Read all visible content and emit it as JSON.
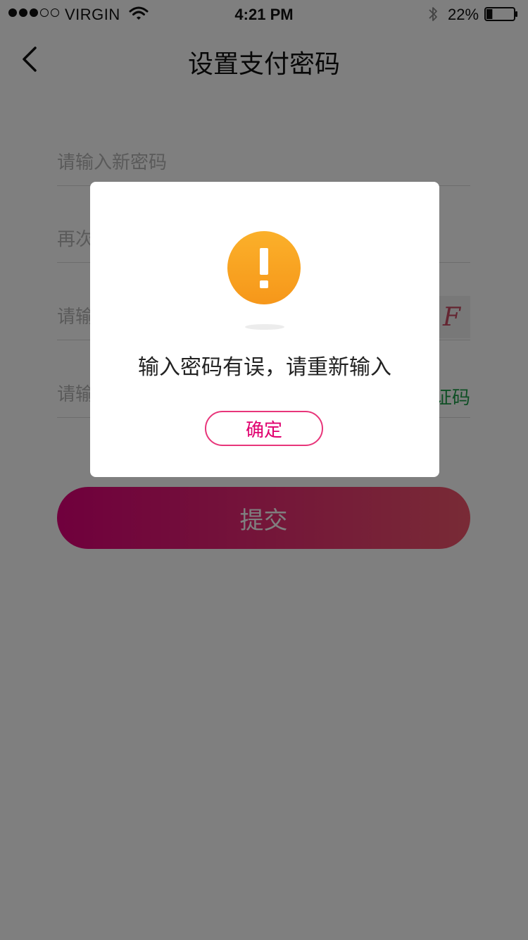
{
  "status_bar": {
    "carrier": "VIRGIN",
    "time": "4:21 PM",
    "battery_percent": "22%",
    "battery_level": 0.22,
    "signal_bars_filled": 3,
    "signal_bars_total": 5
  },
  "nav": {
    "back_icon": "chevron-left-icon",
    "title": "设置支付密码"
  },
  "form": {
    "new_password_placeholder": "请输入新密码",
    "confirm_password_placeholder": "再次",
    "captcha_placeholder": "请输",
    "captcha_text": "F",
    "sms_code_placeholder": "请输",
    "sms_code_link": "证码",
    "submit_label": "提交"
  },
  "dialog": {
    "icon": "exclamation-warning-icon",
    "message": "输入密码有误，请重新输入",
    "confirm_label": "确定"
  },
  "colors": {
    "brand_gradient_start": "#e0007a",
    "brand_gradient_end": "#f2566c",
    "warning_orange": "#fba51f",
    "link_green": "#1e9e4a",
    "overlay": "rgba(0,0,0,0.5)"
  }
}
